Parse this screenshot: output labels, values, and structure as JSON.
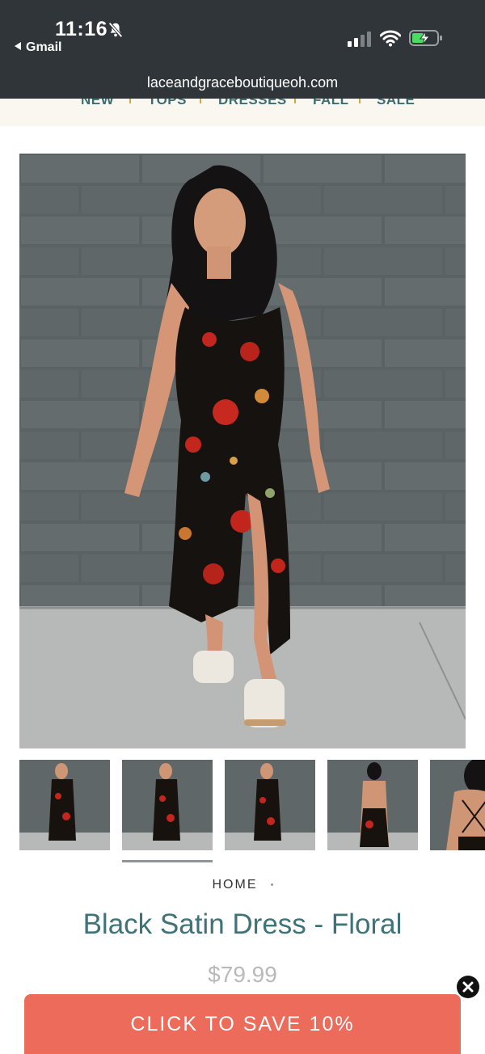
{
  "status_bar": {
    "time": "11:16",
    "back_label": "Gmail",
    "icons": [
      "bell-slash-icon",
      "signal-icon",
      "wifi-icon",
      "battery-charging-icon"
    ]
  },
  "browser": {
    "url": "laceandgraceboutiqueoh.com"
  },
  "nav": {
    "items": [
      "NEW",
      "TOPS",
      "DRESSES",
      "FALL",
      "SALE"
    ]
  },
  "product": {
    "breadcrumb": "HOME",
    "title": "Black Satin Dress - Floral",
    "price": "$79.99",
    "thumbnail_count": 5,
    "selected_thumbnail": 2
  },
  "promo": {
    "cta_label": "CLICK TO SAVE 10%"
  },
  "colors": {
    "topbar": "#2f3538",
    "nav_text": "#3b6e73",
    "title": "#3f7377",
    "cta": "#ec6b5a"
  }
}
